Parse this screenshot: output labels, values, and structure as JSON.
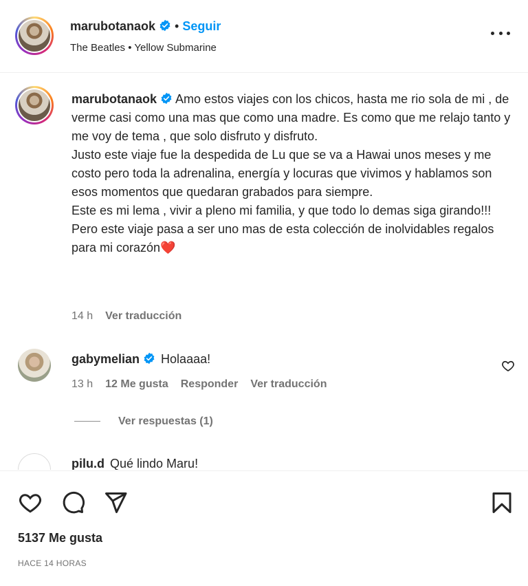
{
  "header": {
    "username": "marubotanaok",
    "follow_label": "Seguir",
    "separator": "•",
    "subtitle": "The Beatles • Yellow Submarine"
  },
  "caption": {
    "username": "marubotanaok",
    "text": "Amo estos viajes con los chicos, hasta me rio sola de mi , de verme casi como una mas que como una madre. Es como que me relajo tanto y me voy de tema , que solo disfruto y disfruto.\nJusto este viaje fue la despedida de Lu que se va a Hawai unos meses y me costo pero toda la adrenalina, energía y locuras que vivimos y hablamos son esos momentos que quedaran grabados para siempre.\nEste es mi lema , vivir a pleno mi familia, y que todo lo demas siga girando!!! Pero este viaje pasa a ser uno mas de esta colección de inolvidables regalos para mi corazón",
    "emoji": "❤️",
    "time": "14 h",
    "translate_label": "Ver traducción"
  },
  "comments": [
    {
      "username": "gabymelian",
      "text": "Holaaaa!",
      "time": "13 h",
      "likes": "12 Me gusta",
      "reply_label": "Responder",
      "translate_label": "Ver traducción",
      "replies_label": "Ver respuestas (1)"
    },
    {
      "username": "pilu.d",
      "text": "Qué lindo Maru!"
    }
  ],
  "actions": {
    "likes_count": "5137 Me gusta",
    "time_ago": "HACE 14 HORAS"
  },
  "colors": {
    "follow": "#0095f6",
    "verified": "#0095f6",
    "heart_emoji": "#e0245e"
  },
  "icons": [
    "more-icon",
    "verified-icon",
    "heart-icon",
    "comment-icon",
    "share-icon",
    "bookmark-icon"
  ]
}
